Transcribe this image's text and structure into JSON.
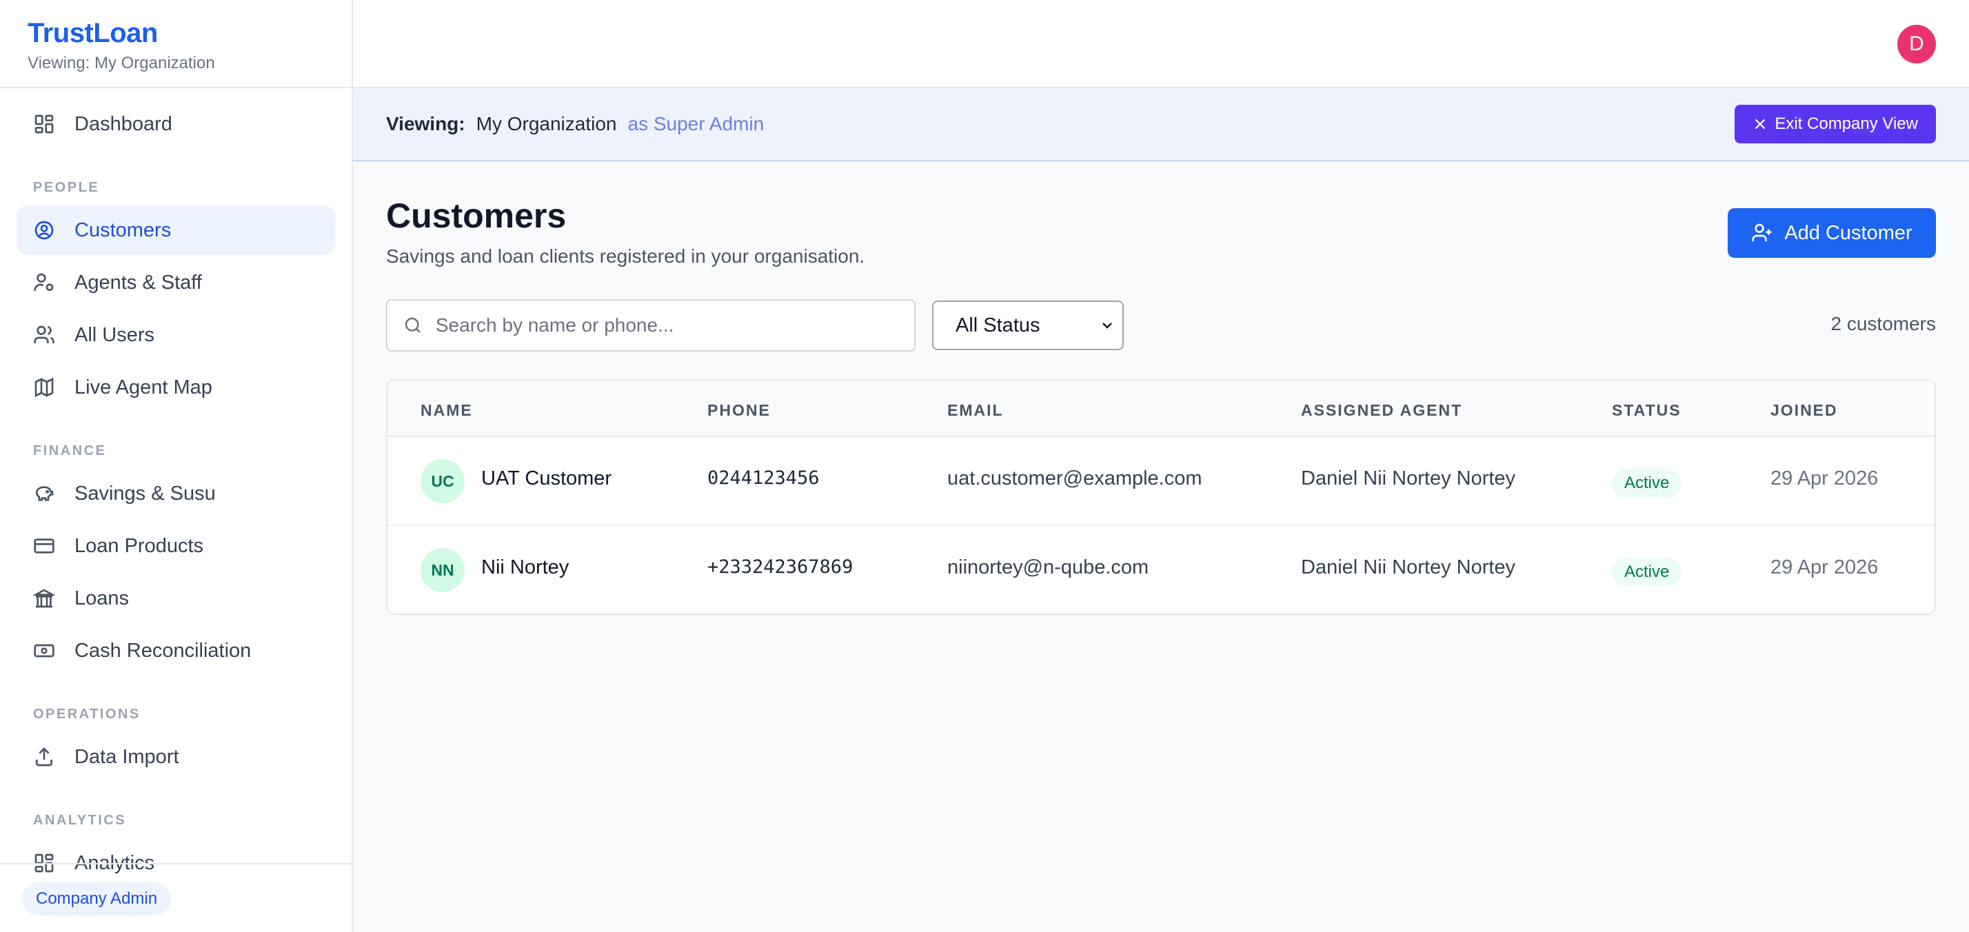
{
  "brand": {
    "title": "TrustLoan",
    "subtitle": "Viewing: My Organization"
  },
  "sidebar": {
    "items": [
      {
        "label": "Dashboard",
        "icon": "dashboard-icon"
      },
      {
        "section": "PEOPLE"
      },
      {
        "label": "Customers",
        "icon": "user-circle-icon",
        "active": true
      },
      {
        "label": "Agents & Staff",
        "icon": "user-cog-icon"
      },
      {
        "label": "All Users",
        "icon": "users-icon"
      },
      {
        "label": "Live Agent Map",
        "icon": "map-icon"
      },
      {
        "section": "FINANCE"
      },
      {
        "label": "Savings & Susu",
        "icon": "piggy-bank-icon"
      },
      {
        "label": "Loan Products",
        "icon": "credit-card-icon"
      },
      {
        "label": "Loans",
        "icon": "bank-icon"
      },
      {
        "label": "Cash Reconciliation",
        "icon": "banknote-icon"
      },
      {
        "section": "OPERATIONS"
      },
      {
        "label": "Data Import",
        "icon": "upload-icon"
      },
      {
        "section": "ANALYTICS"
      },
      {
        "label": "Analytics",
        "icon": "dashboard-icon"
      }
    ],
    "footer_badge": "Company Admin"
  },
  "topbar": {
    "avatar_letter": "D"
  },
  "viewbar": {
    "label": "Viewing:",
    "org": "My Organization",
    "role": "as Super Admin",
    "exit_label": "Exit Company View"
  },
  "page": {
    "title": "Customers",
    "subtitle": "Savings and loan clients registered in your organisation.",
    "add_label": "Add Customer",
    "search_placeholder": "Search by name or phone...",
    "status_filter": "All Status",
    "count": "2 customers"
  },
  "table": {
    "headers": [
      "NAME",
      "PHONE",
      "EMAIL",
      "ASSIGNED AGENT",
      "STATUS",
      "JOINED"
    ],
    "rows": [
      {
        "initials": "UC",
        "name": "UAT Customer",
        "phone": "0244123456",
        "email": "uat.customer@example.com",
        "agent": "Daniel Nii Nortey Nortey",
        "status": "Active",
        "joined": "29 Apr 2026"
      },
      {
        "initials": "NN",
        "name": "Nii Nortey",
        "phone": "+233242367869",
        "email": "niinortey@n-qube.com",
        "agent": "Daniel Nii Nortey Nortey",
        "status": "Active",
        "joined": "29 Apr 2026"
      }
    ]
  },
  "colors": {
    "accent": "#1d64f2",
    "exit_button": "#5b35f0",
    "avatar": "#e8336f",
    "status_active": "#047857"
  }
}
